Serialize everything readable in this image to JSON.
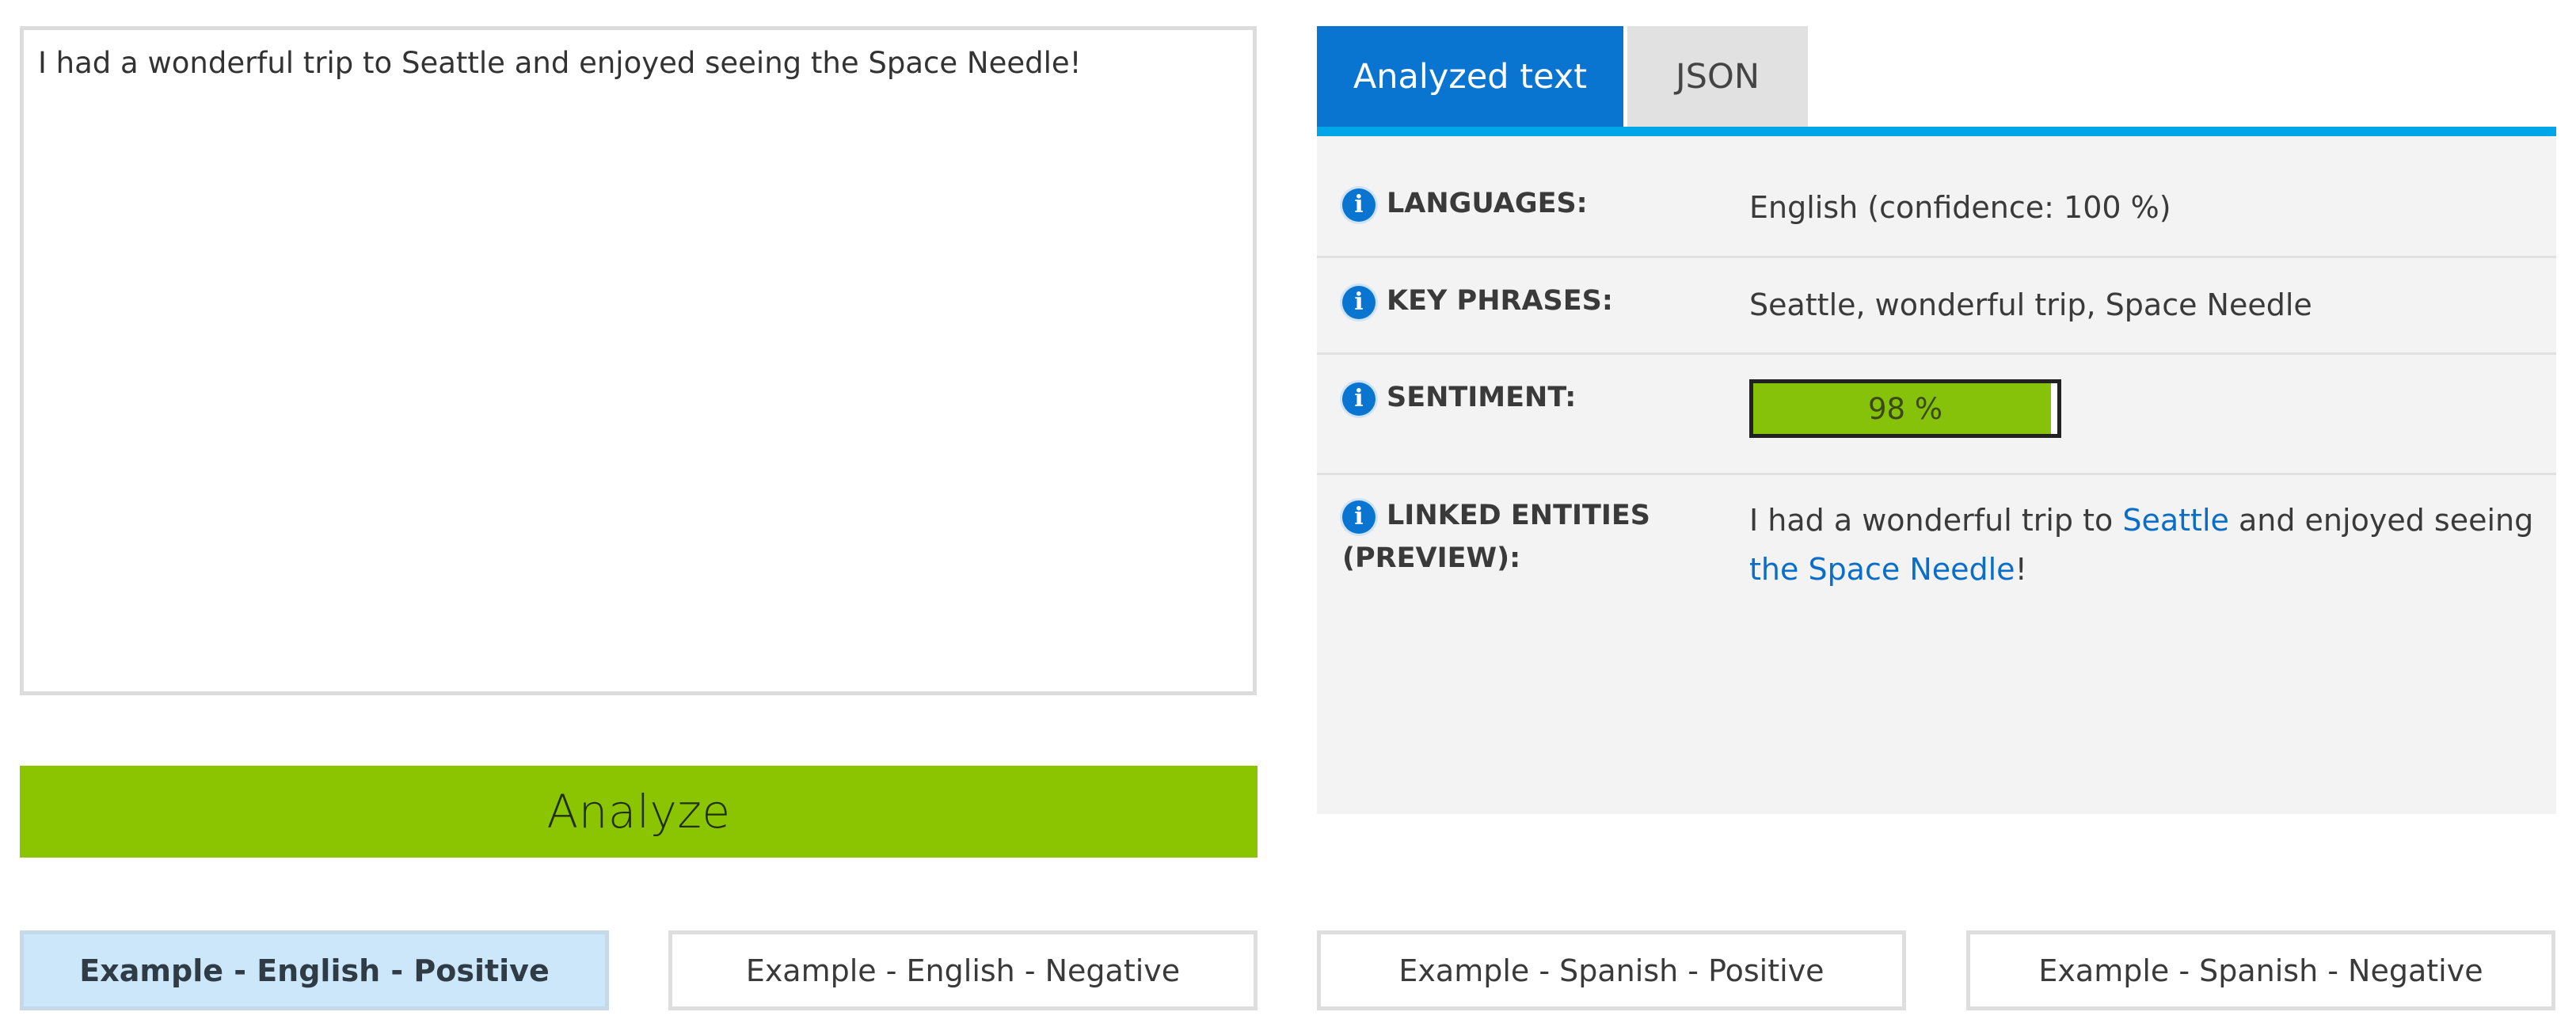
{
  "input": {
    "text": "I had a wonderful trip to Seattle and enjoyed seeing the Space Needle!"
  },
  "analyze_button": {
    "label": "Analyze"
  },
  "tabs": [
    {
      "label": "Analyzed text",
      "active": true
    },
    {
      "label": "JSON",
      "active": false
    }
  ],
  "results": {
    "languages": {
      "label": "LANGUAGES:",
      "value": "English (confidence: 100 %)"
    },
    "key_phrases": {
      "label": "KEY PHRASES:",
      "value": "Seattle, wonderful trip, Space Needle"
    },
    "sentiment": {
      "label": "SENTIMENT:",
      "value_text": "98 %",
      "value": 0.98
    },
    "linked_entities": {
      "label_line1": "LINKED ENTITIES",
      "label_line2": "(PREVIEW):",
      "segments": [
        {
          "text": "I had a wonderful trip to ",
          "link": false
        },
        {
          "text": "Seattle",
          "link": true
        },
        {
          "text": " and enjoyed seeing ",
          "link": false
        },
        {
          "text": "the Space Needle",
          "link": true
        },
        {
          "text": "!",
          "link": false
        }
      ]
    }
  },
  "examples": [
    {
      "label": "Example - English - Positive",
      "selected": true
    },
    {
      "label": "Example - English - Negative",
      "selected": false
    },
    {
      "label": "Example - Spanish - Positive",
      "selected": false
    },
    {
      "label": "Example - Spanish - Negative",
      "selected": false
    }
  ],
  "colors": {
    "tab_active": "#0a74d1",
    "tab_underline": "#00a6e8",
    "analyze_button": "#8bc400",
    "sentiment_fill": "#86c20a",
    "entity_link": "#0a6ec8",
    "example_selected": "#cce6fa"
  },
  "icons": {
    "info": "info-icon"
  }
}
